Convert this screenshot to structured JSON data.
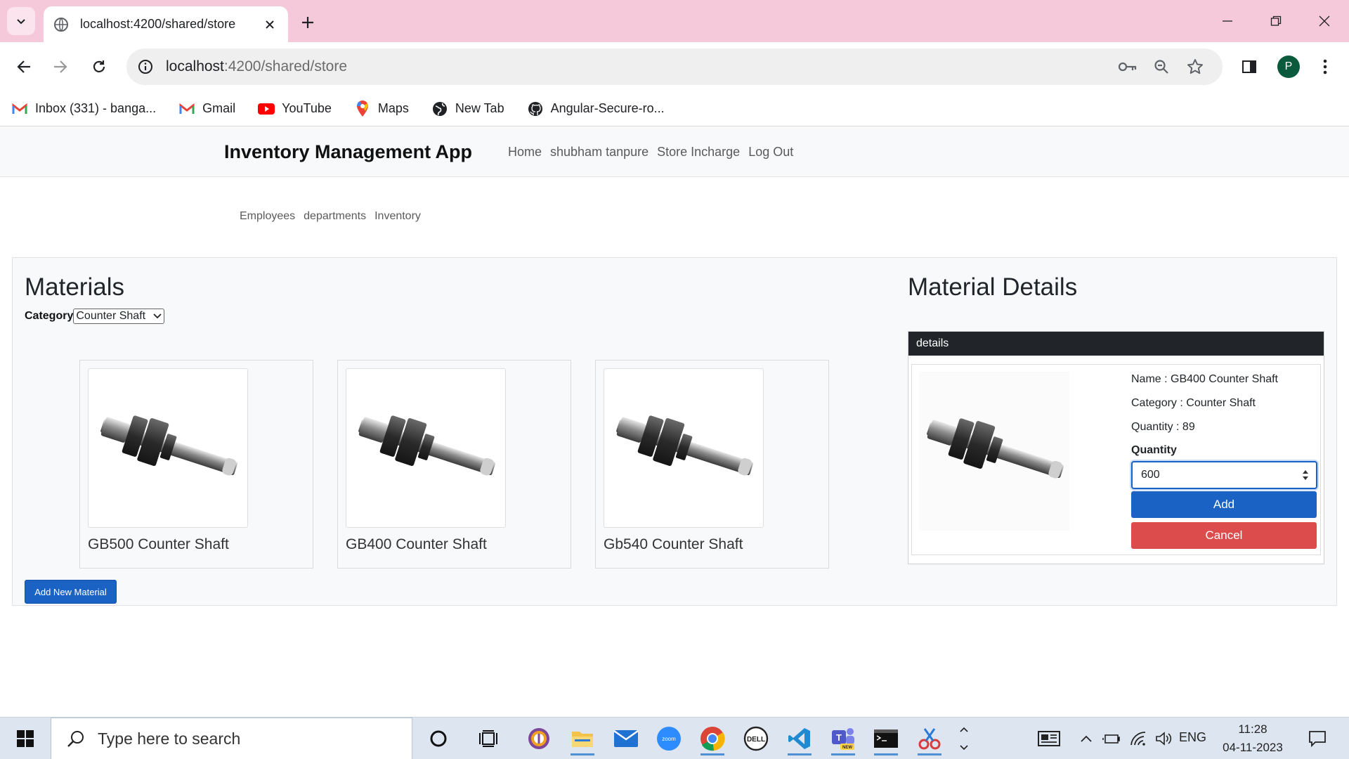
{
  "browser": {
    "tab_title": "localhost:4200/shared/store",
    "url_host": "localhost",
    "url_path": ":4200/shared/store",
    "profile_initial": "P",
    "bookmarks": [
      {
        "label": "Inbox (331) - banga...",
        "icon": "gmail-icon"
      },
      {
        "label": "Gmail",
        "icon": "gmail-icon"
      },
      {
        "label": "YouTube",
        "icon": "youtube-icon"
      },
      {
        "label": "Maps",
        "icon": "maps-icon"
      },
      {
        "label": "New Tab",
        "icon": "globe-icon"
      },
      {
        "label": "Angular-Secure-ro...",
        "icon": "github-icon"
      }
    ]
  },
  "navbar": {
    "brand": "Inventory Management App",
    "links": [
      "Home",
      "shubham tanpure",
      "Store Incharge",
      "Log Out"
    ]
  },
  "subnav": {
    "links": [
      "Employees",
      "departments",
      "Inventory"
    ]
  },
  "materials": {
    "heading": "Materials",
    "category_label": "Category",
    "category_selected": "Counter Shaft",
    "items": [
      {
        "name": "GB500 Counter Shaft"
      },
      {
        "name": "GB400 Counter Shaft"
      },
      {
        "name": "Gb540 Counter Shaft"
      }
    ],
    "add_button": "Add New Material"
  },
  "details": {
    "heading": "Material Details",
    "panel_title": "details",
    "name_line": "Name : GB400 Counter Shaft",
    "category_line": "Category : Counter Shaft",
    "quantity_line": "Quantity : 89",
    "quantity_label": "Quantity",
    "quantity_value": "600",
    "add_button": "Add",
    "cancel_button": "Cancel"
  },
  "taskbar": {
    "search_placeholder": "Type here to search",
    "language": "ENG",
    "time": "11:28",
    "date": "04-11-2023"
  },
  "colors": {
    "primary": "#1a62c4",
    "danger": "#dc4c4c",
    "dark_header": "#212529",
    "tabstrip": "#f5c9da"
  }
}
